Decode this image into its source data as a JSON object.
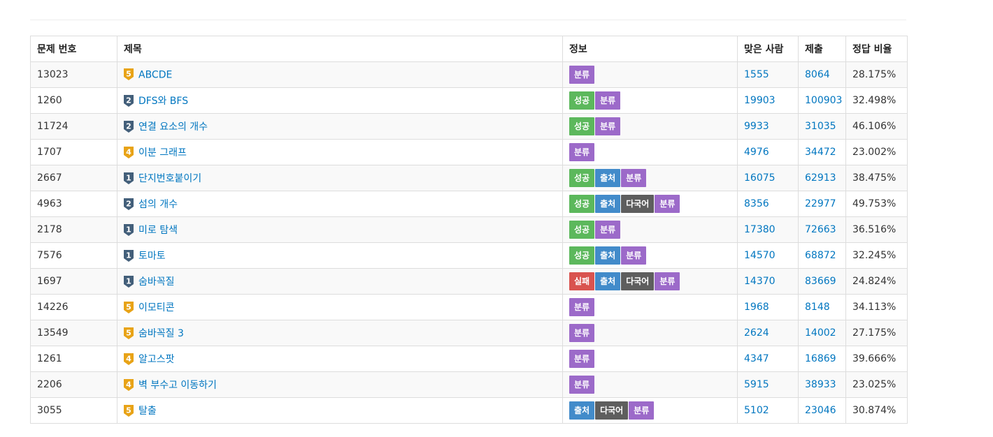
{
  "columns": {
    "id": "문제 번호",
    "title": "제목",
    "info": "정보",
    "accepted": "맞은 사람",
    "submissions": "제출",
    "ratio": "정답 비율"
  },
  "colors": {
    "gold": "#e8a317",
    "silver": "#435f7a",
    "link": "#0076c0",
    "label_classify": "#9c6ac9",
    "label_success": "#5cb85c",
    "label_source": "#428bca",
    "label_multilang": "#5e5e5e",
    "label_fail": "#d9534f"
  },
  "rows": [
    {
      "id": "13023",
      "tier": "5",
      "tier_color": "gold",
      "title": "ABCDE",
      "labels": [
        {
          "text": "분류",
          "kind": "purple"
        }
      ],
      "accepted": "1555",
      "submissions": "8064",
      "ratio": "28.175%"
    },
    {
      "id": "1260",
      "tier": "2",
      "tier_color": "silver",
      "title": "DFS와 BFS",
      "labels": [
        {
          "text": "성공",
          "kind": "green"
        },
        {
          "text": "분류",
          "kind": "purple"
        }
      ],
      "accepted": "19903",
      "submissions": "100903",
      "ratio": "32.498%"
    },
    {
      "id": "11724",
      "tier": "2",
      "tier_color": "silver",
      "title": "연결 요소의 개수",
      "labels": [
        {
          "text": "성공",
          "kind": "green"
        },
        {
          "text": "분류",
          "kind": "purple"
        }
      ],
      "accepted": "9933",
      "submissions": "31035",
      "ratio": "46.106%"
    },
    {
      "id": "1707",
      "tier": "4",
      "tier_color": "gold",
      "title": "이분 그래프",
      "labels": [
        {
          "text": "분류",
          "kind": "purple"
        }
      ],
      "accepted": "4976",
      "submissions": "34472",
      "ratio": "23.002%"
    },
    {
      "id": "2667",
      "tier": "1",
      "tier_color": "silver",
      "title": "단지번호붙이기",
      "labels": [
        {
          "text": "성공",
          "kind": "green"
        },
        {
          "text": "출처",
          "kind": "blue"
        },
        {
          "text": "분류",
          "kind": "purple"
        }
      ],
      "accepted": "16075",
      "submissions": "62913",
      "ratio": "38.475%"
    },
    {
      "id": "4963",
      "tier": "2",
      "tier_color": "silver",
      "title": "섬의 개수",
      "labels": [
        {
          "text": "성공",
          "kind": "green"
        },
        {
          "text": "출처",
          "kind": "blue"
        },
        {
          "text": "다국어",
          "kind": "dark"
        },
        {
          "text": "분류",
          "kind": "purple"
        }
      ],
      "accepted": "8356",
      "submissions": "22977",
      "ratio": "49.753%"
    },
    {
      "id": "2178",
      "tier": "1",
      "tier_color": "silver",
      "title": "미로 탐색",
      "labels": [
        {
          "text": "성공",
          "kind": "green"
        },
        {
          "text": "분류",
          "kind": "purple"
        }
      ],
      "accepted": "17380",
      "submissions": "72663",
      "ratio": "36.516%"
    },
    {
      "id": "7576",
      "tier": "1",
      "tier_color": "silver",
      "title": "토마토",
      "labels": [
        {
          "text": "성공",
          "kind": "green"
        },
        {
          "text": "출처",
          "kind": "blue"
        },
        {
          "text": "분류",
          "kind": "purple"
        }
      ],
      "accepted": "14570",
      "submissions": "68872",
      "ratio": "32.245%"
    },
    {
      "id": "1697",
      "tier": "1",
      "tier_color": "silver",
      "title": "숨바꼭질",
      "labels": [
        {
          "text": "실패",
          "kind": "red"
        },
        {
          "text": "출처",
          "kind": "blue"
        },
        {
          "text": "다국어",
          "kind": "dark"
        },
        {
          "text": "분류",
          "kind": "purple"
        }
      ],
      "accepted": "14370",
      "submissions": "83669",
      "ratio": "24.824%"
    },
    {
      "id": "14226",
      "tier": "5",
      "tier_color": "gold",
      "title": "이모티콘",
      "labels": [
        {
          "text": "분류",
          "kind": "purple"
        }
      ],
      "accepted": "1968",
      "submissions": "8148",
      "ratio": "34.113%"
    },
    {
      "id": "13549",
      "tier": "5",
      "tier_color": "gold",
      "title": "숨바꼭질 3",
      "labels": [
        {
          "text": "분류",
          "kind": "purple"
        }
      ],
      "accepted": "2624",
      "submissions": "14002",
      "ratio": "27.175%"
    },
    {
      "id": "1261",
      "tier": "4",
      "tier_color": "gold",
      "title": "알고스팟",
      "labels": [
        {
          "text": "분류",
          "kind": "purple"
        }
      ],
      "accepted": "4347",
      "submissions": "16869",
      "ratio": "39.666%"
    },
    {
      "id": "2206",
      "tier": "4",
      "tier_color": "gold",
      "title": "벽 부수고 이동하기",
      "labels": [
        {
          "text": "분류",
          "kind": "purple"
        }
      ],
      "accepted": "5915",
      "submissions": "38933",
      "ratio": "23.025%"
    },
    {
      "id": "3055",
      "tier": "5",
      "tier_color": "gold",
      "title": "탈출",
      "labels": [
        {
          "text": "출처",
          "kind": "blue"
        },
        {
          "text": "다국어",
          "kind": "dark"
        },
        {
          "text": "분류",
          "kind": "purple"
        }
      ],
      "accepted": "5102",
      "submissions": "23046",
      "ratio": "30.874%"
    }
  ]
}
